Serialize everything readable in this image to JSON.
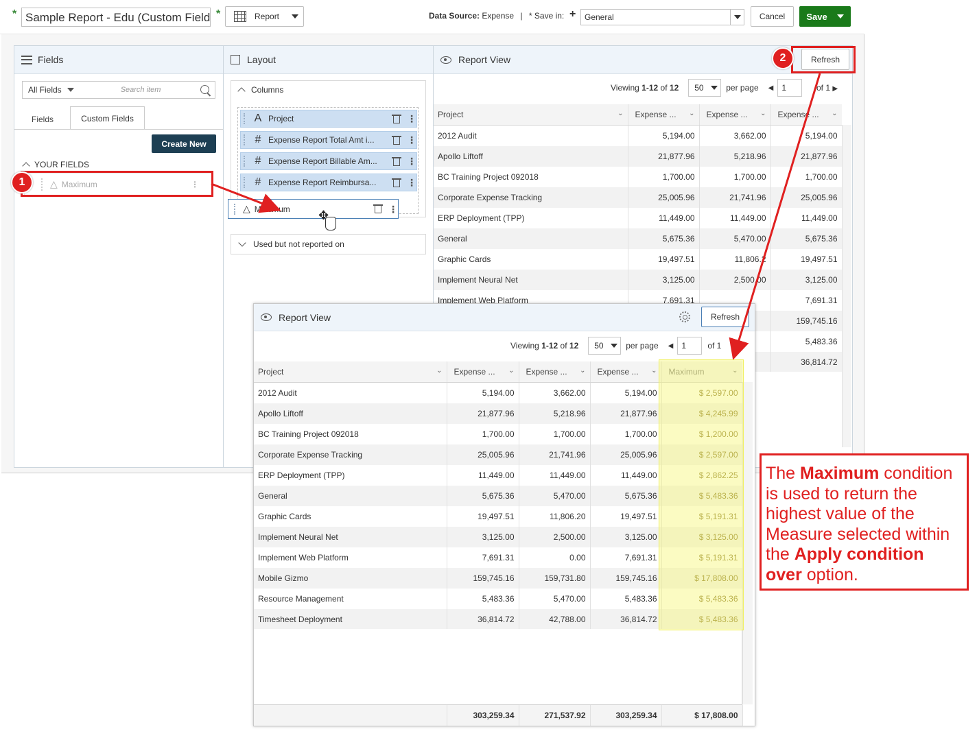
{
  "topbar": {
    "required_mark": "*",
    "report_name": "Sample Report - Edu (Custom Fields",
    "report_type": "Report",
    "data_source_label": "Data Source:",
    "data_source_value": "Expense",
    "separator": "|",
    "save_in_label": "* Save in:",
    "save_in_value": "General",
    "cancel": "Cancel",
    "save": "Save"
  },
  "fields_panel": {
    "title": "Fields",
    "filter": "All Fields",
    "search_placeholder": "Search item",
    "tabs": [
      "Fields",
      "Custom Fields"
    ],
    "create_new": "Create New",
    "section": "YOUR FIELDS",
    "items": [
      "Maximum"
    ]
  },
  "layout_panel": {
    "title": "Layout",
    "columns_title": "Columns",
    "columns": [
      {
        "type": "A",
        "label": "Project"
      },
      {
        "type": "#",
        "label": "Expense Report Total Amt i..."
      },
      {
        "type": "#",
        "label": "Expense Report Billable Am..."
      },
      {
        "type": "#",
        "label": "Expense Report Reimbursa..."
      }
    ],
    "dragging": {
      "type": "△",
      "label": "Maximum"
    },
    "unused_title": "Used but not reported on"
  },
  "report_back": {
    "title": "Report View",
    "refresh": "Refresh",
    "viewing": "Viewing",
    "range": "1-12",
    "of": "of",
    "total": "12",
    "per_page_value": "50",
    "per_page": "per page",
    "page": "1",
    "of_pages": "of 1",
    "headers": [
      "Project",
      "Expense ...",
      "Expense ...",
      "Expense ..."
    ],
    "rows": [
      [
        "2012 Audit",
        "5,194.00",
        "3,662.00",
        "5,194.00"
      ],
      [
        "Apollo Liftoff",
        "21,877.96",
        "5,218.96",
        "21,877.96"
      ],
      [
        "BC Training Project 092018",
        "1,700.00",
        "1,700.00",
        "1,700.00"
      ],
      [
        "Corporate Expense Tracking",
        "25,005.96",
        "21,741.96",
        "25,005.96"
      ],
      [
        "ERP Deployment (TPP)",
        "11,449.00",
        "11,449.00",
        "11,449.00"
      ],
      [
        "General",
        "5,675.36",
        "5,470.00",
        "5,675.36"
      ],
      [
        "Graphic Cards",
        "19,497.51",
        "11,806.2",
        "19,497.51"
      ],
      [
        "Implement Neural Net",
        "3,125.00",
        "2,500.00",
        "3,125.00"
      ],
      [
        "Implement Web Platform",
        "7,691.31",
        "",
        "7,691.31"
      ],
      [
        "",
        "",
        "",
        "159,745.16"
      ],
      [
        "",
        "",
        "",
        "5,483.36"
      ],
      [
        "",
        "",
        "",
        "36,814.72"
      ]
    ]
  },
  "report_front": {
    "title": "Report View",
    "refresh": "Refresh",
    "viewing": "Viewing",
    "range": "1-12",
    "of": "of",
    "total": "12",
    "per_page_value": "50",
    "per_page": "per page",
    "page": "1",
    "of_pages": "of 1",
    "headers": [
      "Project",
      "Expense ...",
      "Expense ...",
      "Expense ...",
      "Maximum"
    ],
    "rows": [
      [
        "2012 Audit",
        "5,194.00",
        "3,662.00",
        "5,194.00",
        "$ 2,597.00"
      ],
      [
        "Apollo Liftoff",
        "21,877.96",
        "5,218.96",
        "21,877.96",
        "$ 4,245.99"
      ],
      [
        "BC Training Project 092018",
        "1,700.00",
        "1,700.00",
        "1,700.00",
        "$ 1,200.00"
      ],
      [
        "Corporate Expense Tracking",
        "25,005.96",
        "21,741.96",
        "25,005.96",
        "$ 2,597.00"
      ],
      [
        "ERP Deployment (TPP)",
        "11,449.00",
        "11,449.00",
        "11,449.00",
        "$ 2,862.25"
      ],
      [
        "General",
        "5,675.36",
        "5,470.00",
        "5,675.36",
        "$ 5,483.36"
      ],
      [
        "Graphic Cards",
        "19,497.51",
        "11,806.20",
        "19,497.51",
        "$ 5,191.31"
      ],
      [
        "Implement Neural Net",
        "3,125.00",
        "2,500.00",
        "3,125.00",
        "$ 3,125.00"
      ],
      [
        "Implement Web Platform",
        "7,691.31",
        "0.00",
        "7,691.31",
        "$ 5,191.31"
      ],
      [
        "Mobile Gizmo",
        "159,745.16",
        "159,731.80",
        "159,745.16",
        "$ 17,808.00"
      ],
      [
        "Resource Management",
        "5,483.36",
        "5,470.00",
        "5,483.36",
        "$ 5,483.36"
      ],
      [
        "Timesheet Deployment",
        "36,814.72",
        "42,788.00",
        "36,814.72",
        "$ 5,483.36"
      ]
    ],
    "totals": [
      "",
      "303,259.34",
      "271,537.92",
      "303,259.34",
      "$ 17,808.00"
    ]
  },
  "callouts": {
    "marker1": "1",
    "marker2": "2",
    "note_parts": [
      "The ",
      "Maximum",
      " condition is used to return the highest value of the Measure selected within the ",
      "Apply condition over",
      " option."
    ]
  },
  "colors": {
    "save_green": "#1a7a1a",
    "create_new": "#1d3f53",
    "highlight_yellow": "#f7f7a6",
    "callout_red": "#e02020"
  }
}
